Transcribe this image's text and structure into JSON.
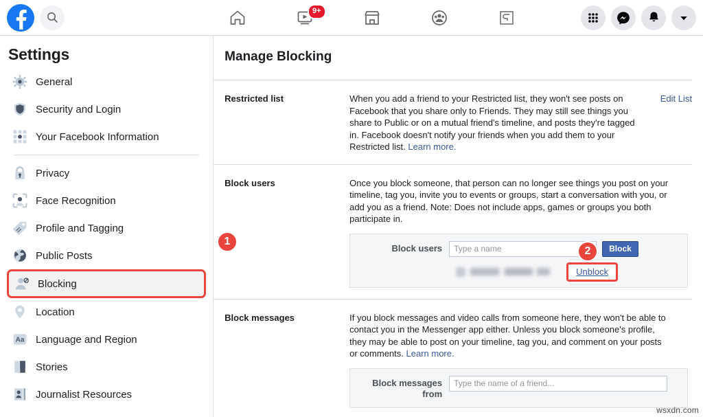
{
  "topbar": {
    "logo": "facebook-logo",
    "search_icon": "search-icon",
    "icons": [
      {
        "name": "home-icon",
        "label": "Home"
      },
      {
        "name": "watch-icon",
        "label": "Watch",
        "badge": "9+"
      },
      {
        "name": "marketplace-icon",
        "label": "Marketplace"
      },
      {
        "name": "groups-icon",
        "label": "Groups"
      },
      {
        "name": "gaming-icon",
        "label": "Gaming"
      }
    ],
    "right_icons": [
      {
        "name": "grid-menu-icon",
        "label": "Menu"
      },
      {
        "name": "messenger-icon",
        "label": "Messenger"
      },
      {
        "name": "notifications-bell-icon",
        "label": "Notifications"
      },
      {
        "name": "account-chevron-down-icon",
        "label": "Account"
      }
    ]
  },
  "sidebar": {
    "title": "Settings",
    "items": [
      {
        "label": "General",
        "icon": "gear-icon"
      },
      {
        "label": "Security and Login",
        "icon": "shield-icon"
      },
      {
        "label": "Your Facebook Information",
        "icon": "grid-dots-icon"
      },
      {
        "label": "Privacy",
        "icon": "lock-icon"
      },
      {
        "label": "Face Recognition",
        "icon": "face-recognition-icon"
      },
      {
        "label": "Profile and Tagging",
        "icon": "tag-icon"
      },
      {
        "label": "Public Posts",
        "icon": "globe-icon"
      },
      {
        "label": "Blocking",
        "icon": "blocked-person-icon"
      },
      {
        "label": "Location",
        "icon": "location-pin-icon"
      },
      {
        "label": "Language and Region",
        "icon": "language-aa-icon"
      },
      {
        "label": "Stories",
        "icon": "book-icon"
      },
      {
        "label": "Journalist Resources",
        "icon": "journalist-icon"
      }
    ],
    "active_item": "Blocking"
  },
  "main": {
    "title": "Manage Blocking",
    "sections": {
      "restricted_list": {
        "label": "Restricted list",
        "description": "When you add a friend to your Restricted list, they won't see posts on Facebook that you share only to Friends. They may still see things you share to Public or on a mutual friend's timeline, and posts they're tagged in. Facebook doesn't notify your friends when you add them to your Restricted list. ",
        "learn_more": "Learn more.",
        "edit_link": "Edit List"
      },
      "block_users": {
        "label": "Block users",
        "description": "Once you block someone, that person can no longer see things you post on your timeline, tag you, invite you to events or groups, start a conversation with you, or add you as a friend. Note: Does not include apps, games or groups you both participate in.",
        "form_label": "Block users",
        "input_placeholder": "Type a name",
        "input_value": "",
        "block_button": "Block",
        "unblock_link": "Unblock"
      },
      "block_messages": {
        "label": "Block messages",
        "description": "If you block messages and video calls from someone here, they won't be able to contact you in the Messenger app either. Unless you block someone's profile, they may be able to post on your timeline, tag you, and comment on your posts or comments. ",
        "learn_more": "Learn more.",
        "form_label_line1": "Block messages",
        "form_label_line2": "from",
        "input_placeholder": "Type the name of a friend...",
        "input_value": ""
      }
    }
  },
  "markers": [
    {
      "id": "1",
      "label": "1",
      "target": "sidebar-item-blocking"
    },
    {
      "id": "2",
      "label": "2",
      "target": "unblock-link"
    }
  ],
  "watermark": "wsxdn.com",
  "colors": {
    "facebook_blue": "#1877f2",
    "button_blue": "#4267b2",
    "link_blue": "#385898",
    "marker_red": "#e8453c",
    "badge_red": "#e4192e"
  }
}
